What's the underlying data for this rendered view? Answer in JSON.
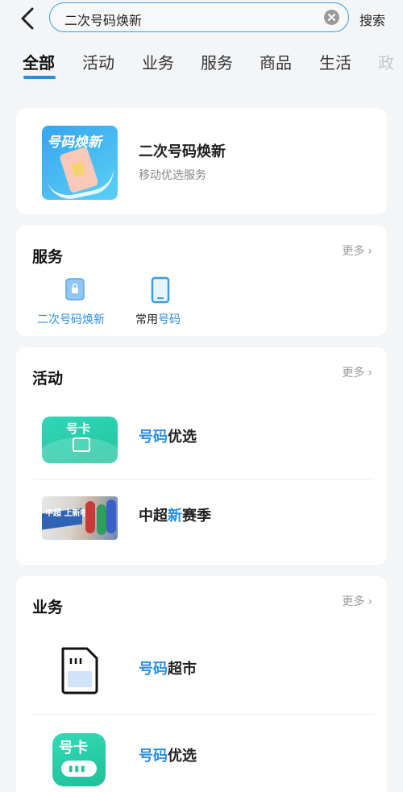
{
  "header": {
    "search_value": "二次号码焕新",
    "search_button": "搜索"
  },
  "tabs": [
    "全部",
    "活动",
    "业务",
    "服务",
    "商品",
    "生活",
    "政"
  ],
  "top_result": {
    "thumb_text": "号码焕新",
    "title": "二次号码焕新",
    "subtitle": "移动优选服务"
  },
  "services_section": {
    "title": "服务",
    "more": "更多",
    "items": [
      {
        "label": "二次号码焕新"
      },
      {
        "label_plain": "常用",
        "label_highlight": "号码"
      }
    ]
  },
  "activities_section": {
    "title": "活动",
    "more": "更多",
    "items": [
      {
        "thumb_text": "号卡",
        "title_highlight": "号码",
        "title_plain": "优选"
      },
      {
        "thumb_text": "中超 上新啦",
        "title_plain1": "中超",
        "title_highlight": "新",
        "title_plain2": "赛季"
      }
    ]
  },
  "business_section": {
    "title": "业务",
    "more": "更多",
    "items": [
      {
        "title_highlight": "号码",
        "title_plain": "超市"
      },
      {
        "thumb_text": "号卡",
        "title_highlight": "号码",
        "title_plain": "优选"
      }
    ]
  },
  "colors": {
    "accent": "#2a8ee0",
    "background": "#f4f5f7",
    "card": "#ffffff",
    "green": "#2fd6b8"
  }
}
